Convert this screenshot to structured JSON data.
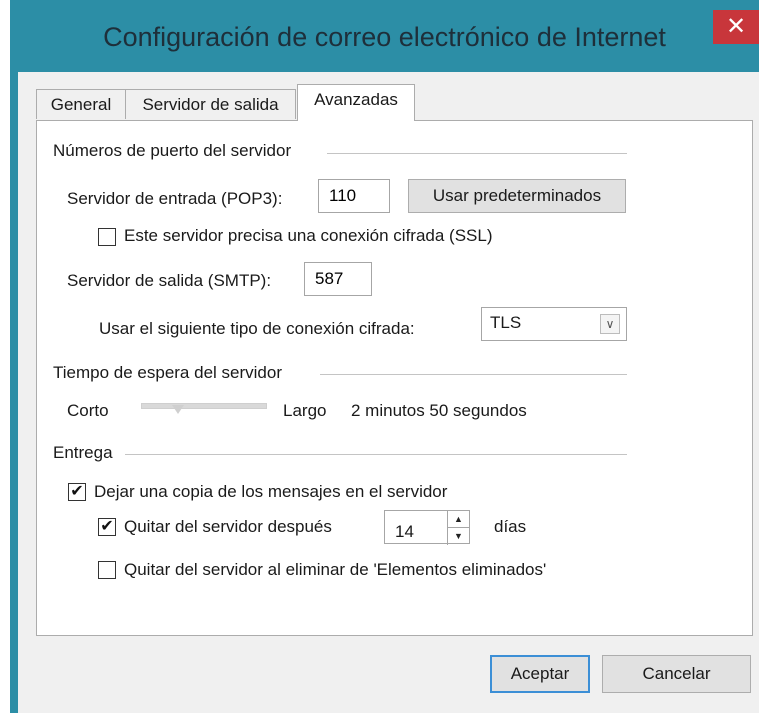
{
  "window": {
    "title": "Configuración de correo electrónico de Internet",
    "close_glyph": "✕"
  },
  "tabs": [
    {
      "label": "General",
      "active": false
    },
    {
      "label": "Servidor de salida",
      "active": false
    },
    {
      "label": "Avanzadas",
      "active": true
    }
  ],
  "ports": {
    "group_label": "Números de puerto del servidor",
    "incoming_label": "Servidor de entrada (POP3):",
    "incoming_value": "110",
    "defaults_button": "Usar predeterminados",
    "ssl_label": "Este servidor precisa una conexión cifrada (SSL)",
    "ssl_checked": false,
    "outgoing_label": "Servidor de salida (SMTP):",
    "outgoing_value": "587",
    "encryption_label": "Usar el siguiente tipo de conexión cifrada:",
    "encryption_value": "TLS"
  },
  "timeout": {
    "group_label": "Tiempo de espera del servidor",
    "short_label": "Corto",
    "long_label": "Largo",
    "value_text": "2 minutos 50 segundos",
    "slider_fraction": 0.28
  },
  "delivery": {
    "group_label": "Entrega",
    "leave_copy_label": "Dejar una copia de los mensajes en el servidor",
    "leave_copy_checked": true,
    "remove_after_label": "Quitar del servidor después",
    "remove_after_checked": true,
    "days_value": "14",
    "days_label": "días",
    "remove_deleted_label": "Quitar del servidor al eliminar de 'Elementos eliminados'",
    "remove_deleted_checked": false
  },
  "footer": {
    "ok_label": "Aceptar",
    "cancel_label": "Cancelar"
  },
  "colors": {
    "window_frame": "#2c8ea6",
    "close_button": "#c8363b",
    "default_button_border": "#3c8fd6"
  }
}
